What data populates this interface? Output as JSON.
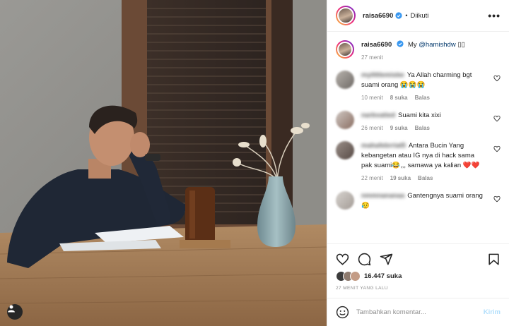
{
  "post": {
    "username": "raisa6690",
    "follow_state": "Diikuti",
    "separator": "•",
    "more_label": "•••"
  },
  "caption": {
    "username": "raisa6690",
    "text_prefix": "My ",
    "mention": "@hamishdw",
    "text_suffix": " ▯▯",
    "time": "27 menit"
  },
  "comments": [
    {
      "user_blurred": "mylittlemisbe",
      "text": "Ya Allah charming bgt suami orang 😭😭😭",
      "time": "10 menit",
      "likes": "8 suka",
      "reply": "Balas"
    },
    {
      "user_blurred": "narbvatied",
      "text": "Suami kita xixi",
      "time": "26 menit",
      "likes": "9 suka",
      "reply": "Balas"
    },
    {
      "user_blurred": "mahafebrriat5",
      "text": "Antara Bucin Yang kebangetan atau IG nya di hack sama pak suami😂,,, samawa ya kalian ❤️❤️",
      "time": "22 menit",
      "likes": "19 suka",
      "reply": "Balas"
    },
    {
      "user_blurred": "nmmnananaa",
      "text": "Gantengnya suami orang 😥",
      "time": "",
      "likes": "",
      "reply": ""
    }
  ],
  "engagement": {
    "likes": "16.447 suka",
    "timestamp": "27 MENIT YANG LALU"
  },
  "composer": {
    "placeholder": "Tambahkan komentar...",
    "post_label": "Kirim"
  },
  "icons": {
    "verified": "verified-badge-icon",
    "like": "heart-icon",
    "comment": "comment-bubble-icon",
    "share": "paper-plane-icon",
    "save": "bookmark-icon",
    "emoji": "smiley-icon",
    "tag": "user-tag-icon"
  },
  "colors": {
    "verified": "#3897f0",
    "link": "#00376b",
    "muted": "#8e8e8e",
    "post_disabled": "#b2dffc"
  }
}
